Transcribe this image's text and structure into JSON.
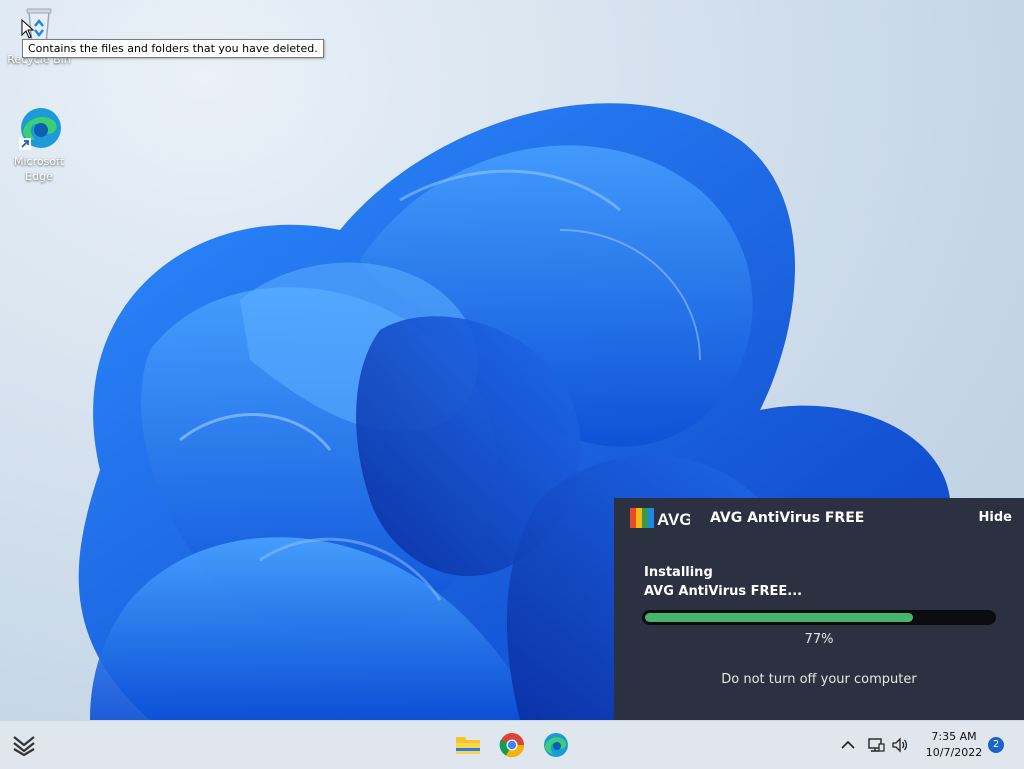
{
  "desktop": {
    "icons": [
      {
        "label": "Recycle Bin",
        "icon": "recycle-bin-icon"
      },
      {
        "label": "Microsoft Edge",
        "icon": "edge-icon"
      }
    ],
    "tooltip": "Contains the files and folders that you have deleted."
  },
  "avg": {
    "logo_text": "AVG",
    "title": "AVG AntiVirus FREE",
    "hide_label": "Hide",
    "status_line1": "Installing",
    "status_line2": "AVG AntiVirus FREE...",
    "progress": 0.77,
    "percent_label": "77%",
    "warning": "Do not turn off your computer",
    "colors": {
      "panel": "#2b3140",
      "progress": "#47b36d"
    }
  },
  "taskbar": {
    "apps": [
      "widgets-icon",
      "file-explorer-icon",
      "chrome-icon",
      "edge-icon"
    ],
    "tray": [
      "chevron-up-icon",
      "network-icon",
      "volume-icon"
    ],
    "time": "7:35 AM",
    "date": "10/7/2022",
    "notification_count": "2"
  }
}
